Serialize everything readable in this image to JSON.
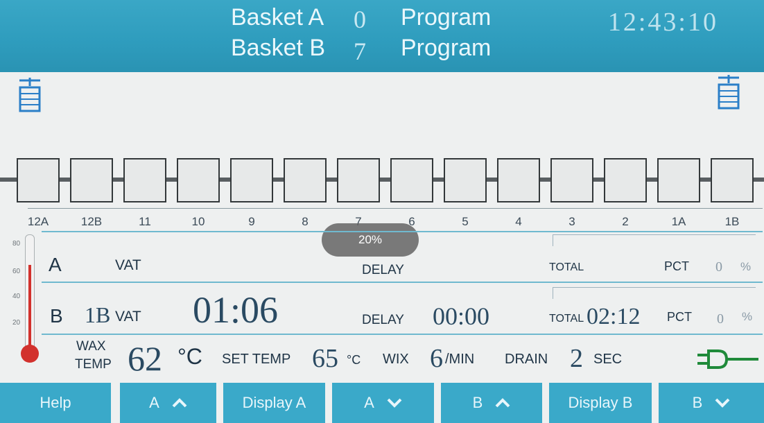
{
  "header": {
    "basket_a_label": "Basket A",
    "basket_a_value": "0",
    "basket_a_program": "Program",
    "basket_b_label": "Basket B",
    "basket_b_value": "7",
    "basket_b_program": "Program",
    "time": "12:43:10"
  },
  "tanks": [
    "12A",
    "12B",
    "11",
    "10",
    "9",
    "8",
    "7",
    "6",
    "5",
    "4",
    "3",
    "2",
    "1A",
    "1B"
  ],
  "progress": {
    "text": "20%",
    "value": 0.2
  },
  "thermometer": {
    "ticks": [
      "80",
      "60",
      "40",
      "20"
    ]
  },
  "row_a": {
    "letter": "A",
    "vat_label": "VAT",
    "delay_label": "DELAY",
    "total_label": "TOTAL",
    "pct_label": "PCT",
    "pct_value": "0",
    "pct_unit": "%"
  },
  "row_b": {
    "letter": "B",
    "tank": "1B",
    "vat_label": "VAT",
    "vat_time": "01:06",
    "delay_label": "DELAY",
    "delay_time": "00:00",
    "total_label": "TOTAL",
    "total_time": "02:12",
    "pct_label": "PCT",
    "pct_value": "0",
    "pct_unit": "%"
  },
  "wax": {
    "label_line1": "WAX",
    "label_line2": "TEMP",
    "temp": "62",
    "temp_unit": "°C",
    "set_temp_label": "SET TEMP",
    "set_temp": "65",
    "set_temp_unit": "°C",
    "wix_label": "WIX",
    "wix_value": "6",
    "wix_unit": "/MIN",
    "drain_label": "DRAIN",
    "drain_value": "2",
    "drain_unit": "SEC"
  },
  "buttons": {
    "help": "Help",
    "a_up": "A",
    "display_a": "Display A",
    "a_down": "A",
    "b_up": "B",
    "display_b": "Display B",
    "b_down": "B"
  },
  "colors": {
    "header": "#2e9cbd",
    "button": "#3aa9c9",
    "accent_line": "#6fb9cf",
    "thermo": "#d2312d",
    "plug": "#1f8a3a"
  },
  "icons": [
    "basket-icon",
    "chevron-up-icon",
    "chevron-down-icon",
    "plug-icon",
    "thermometer-icon"
  ]
}
